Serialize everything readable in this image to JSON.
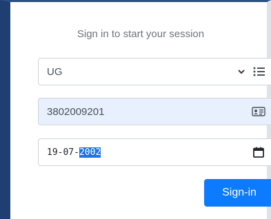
{
  "login": {
    "title": "Sign in to start your session",
    "program": {
      "value": "UG"
    },
    "id_number": {
      "value": "3802009201"
    },
    "dob": {
      "prefix": "19-07-",
      "selected": "2002"
    },
    "submit_label": "Sign-in"
  },
  "colors": {
    "accent": "#0d7bff",
    "autofill_bg": "#e8f0fe",
    "frame": "#1f3f73"
  },
  "icons": {
    "program": "list-icon",
    "id": "id-card-icon",
    "date": "calendar-icon",
    "dropdown": "chevron-down-icon"
  }
}
